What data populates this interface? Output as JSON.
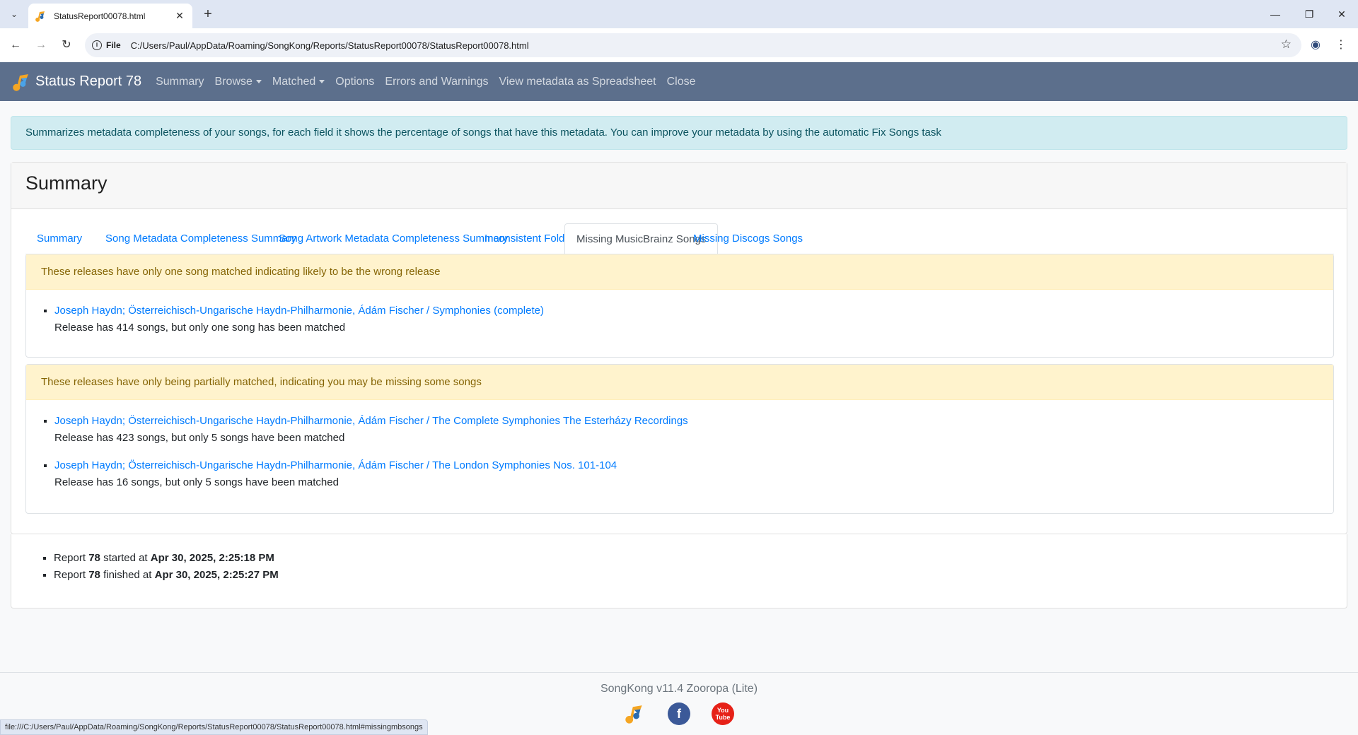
{
  "browser": {
    "tab_title": "StatusReport00078.html",
    "omnibox_scheme": "File",
    "url": "C:/Users/Paul/AppData/Roaming/SongKong/Reports/StatusReport00078/StatusReport00078.html",
    "status_bar_url": "file:///C:/Users/Paul/AppData/Roaming/SongKong/Reports/StatusReport00078/StatusReport00078.html#missingmbsongs"
  },
  "navbar": {
    "brand": "Status Report 78",
    "items": [
      "Summary",
      "Browse",
      "Matched",
      "Options",
      "Errors and Warnings",
      "View metadata as Spreadsheet",
      "Close"
    ],
    "bg_color": "#5c6f8c"
  },
  "info_alert": "Summarizes metadata completeness of your songs, for each field it shows the percentage of songs that have this metadata. You can improve your metadata by using the automatic Fix Songs task",
  "card": {
    "title": "Summary",
    "tabs": [
      "Summary",
      "Song Metadata Completeness Summary",
      "Song Artwork Metadata Completeness Summary",
      "Inconsistent Folders",
      "Missing MusicBrainz Songs",
      "Missing Discogs Songs"
    ],
    "active_tab": "Missing MusicBrainz Songs"
  },
  "panels": [
    {
      "heading": "These releases have only one song matched indicating likely to be the wrong release",
      "items": [
        {
          "link": "Joseph Haydn; Österreichisch-Ungarische Haydn-Philharmonie, Ádám Fischer / Symphonies (complete)",
          "desc": "Release has 414 songs, but only one song has been matched"
        }
      ]
    },
    {
      "heading": "These releases have only being partially matched, indicating you may be missing some songs",
      "items": [
        {
          "link": "Joseph Haydn; Österreichisch-Ungarische Haydn-Philharmonie, Ádám Fischer / The Complete Symphonies The Esterházy Recordings",
          "desc": "Release has 423 songs, but only 5 songs have been matched"
        },
        {
          "link": "Joseph Haydn; Österreichisch-Ungarische Haydn-Philharmonie, Ádám Fischer / The London Symphonies Nos. 101-104",
          "desc": "Release has 16 songs, but only 5 songs have been matched"
        }
      ]
    }
  ],
  "report_times": {
    "report_word": "Report",
    "number": "78",
    "started_label": "started at",
    "started_at": "Apr 30, 2025, 2:25:18 PM",
    "finished_label": "finished at",
    "finished_at": "Apr 30, 2025, 2:25:27 PM"
  },
  "footer": {
    "text": "SongKong v11.4 Zooropa (Lite)",
    "icons": [
      "songkong-icon",
      "facebook-icon",
      "youtube-icon"
    ],
    "youtube_label": "You Tube",
    "facebook_label": "f"
  }
}
